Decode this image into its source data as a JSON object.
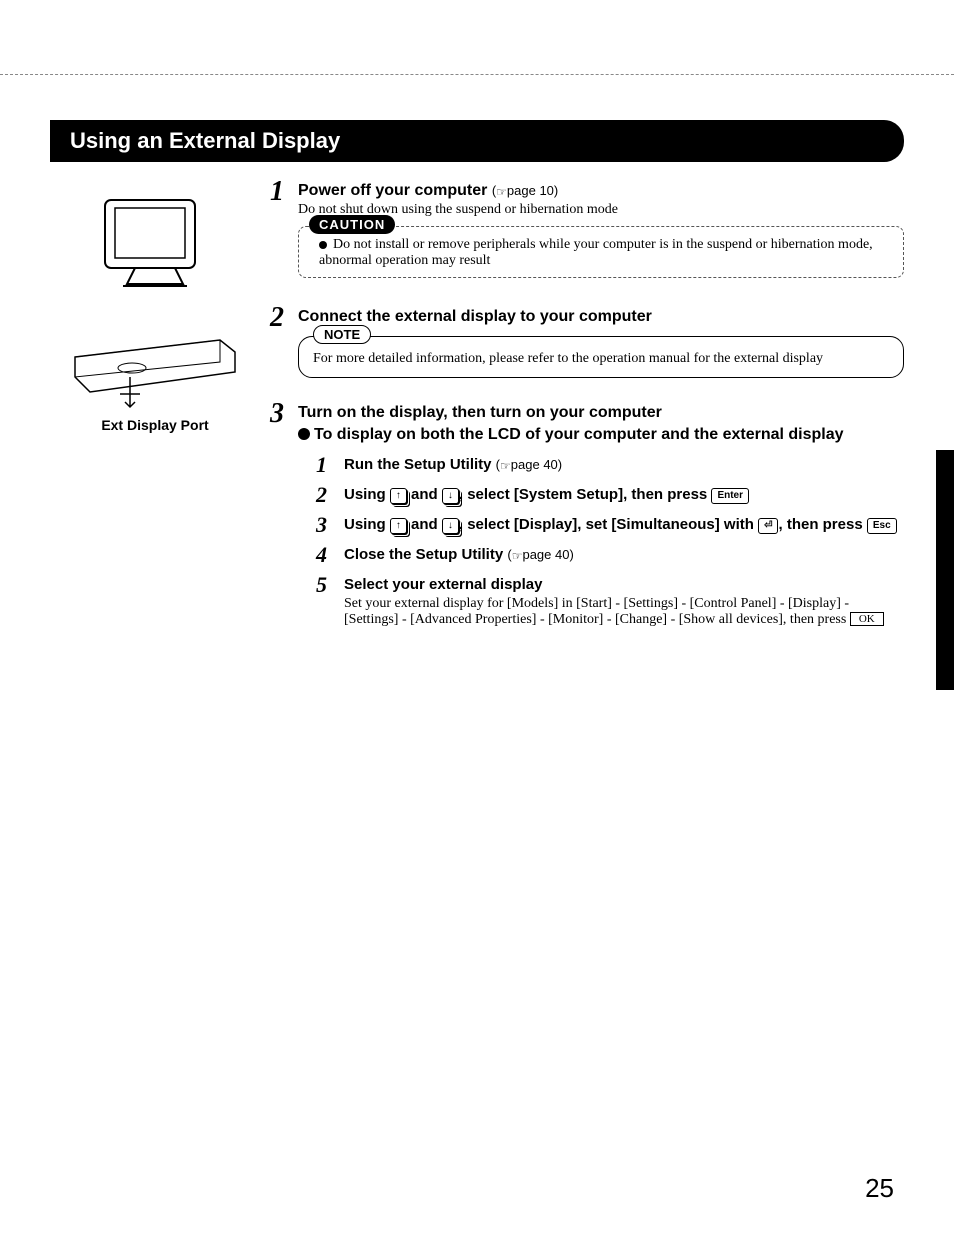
{
  "title": "Using an External Display",
  "left": {
    "port_label": "Ext Display Port"
  },
  "step1": {
    "num": "1",
    "title": "Power off your computer",
    "ref": "page 10",
    "sub": "Do not shut down using the suspend or hibernation mode",
    "caution_label": "CAUTION",
    "caution_text": "Do not install or remove peripherals while your computer is in the suspend or hibernation mode, abnormal operation may result"
  },
  "step2": {
    "num": "2",
    "title": "Connect the external display to your computer",
    "note_label": "NOTE",
    "note_text": "For more detailed information, please refer to the operation manual for the external display"
  },
  "step3": {
    "num": "3",
    "title": "Turn on the display, then turn on your computer",
    "sub_heading": "To display on both the LCD of your computer and the external display"
  },
  "sub1": {
    "num": "1",
    "title": "Run the Setup Utility",
    "ref": "page 40"
  },
  "sub2": {
    "num": "2",
    "t1": "Using ",
    "k1": "↑",
    "t2": " and ",
    "k2": "↓",
    "t3": ", select [System Setup], then press ",
    "k3": "Enter"
  },
  "sub3": {
    "num": "3",
    "t1": "Using ",
    "k1": "↑",
    "t2": " and ",
    "k2": "↓",
    "t3": ", select [Display], set [Simultaneous] with ",
    "k4": "⏎",
    "t4": ", then press ",
    "k5": "Esc"
  },
  "sub4": {
    "num": "4",
    "title": "Close the Setup Utility",
    "ref": "page 40"
  },
  "sub5": {
    "num": "5",
    "title": "Select your external display",
    "body1": "Set your external display for [Models] in [Start] - [Settings] - [Control Panel] - [Display] - [Settings] - [Advanced Properties] - [Monitor] - [Change] - [Show all devices], then press ",
    "ok": "OK"
  },
  "page_number": "25"
}
